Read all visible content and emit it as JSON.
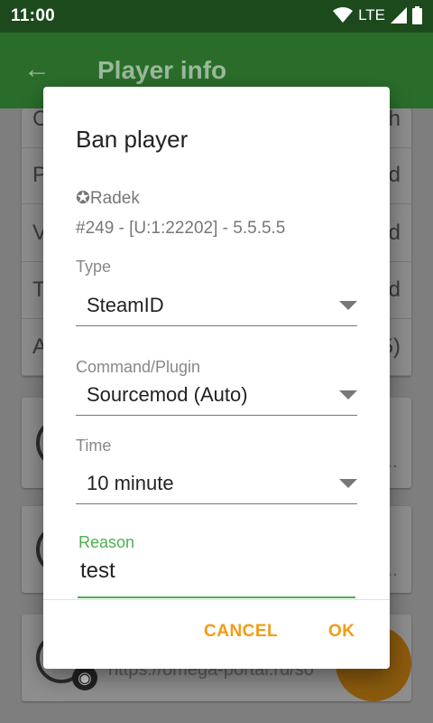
{
  "status_bar": {
    "time": "11:00",
    "network": "LTE"
  },
  "app_bar": {
    "title": "Player info"
  },
  "background": {
    "rows": [
      {
        "left": "C",
        "right": "h"
      },
      {
        "left": "P",
        "right": "d"
      },
      {
        "left": "V",
        "right": "d"
      },
      {
        "left": "T",
        "right": "d"
      },
      {
        "left": "A",
        "right": "5)"
      }
    ],
    "url_text": "https://omega-portal.ru/so",
    "dots": "..."
  },
  "dialog": {
    "title": "Ban player",
    "player_name": "✪Radek",
    "player_info": "#249 - [U:1:22202] - 5.5.5.5",
    "type": {
      "label": "Type",
      "value": "SteamID"
    },
    "command": {
      "label": "Command/Plugin",
      "value": "Sourcemod (Auto)"
    },
    "time": {
      "label": "Time",
      "value": "10 minute"
    },
    "reason": {
      "label": "Reason",
      "value": "test"
    },
    "cancel_label": "CANCEL",
    "ok_label": "OK"
  },
  "colors": {
    "accent": "#4caf50",
    "button": "#f39c12",
    "app_bar": "#2a6d2b",
    "status_bar": "#1c4a1d"
  }
}
